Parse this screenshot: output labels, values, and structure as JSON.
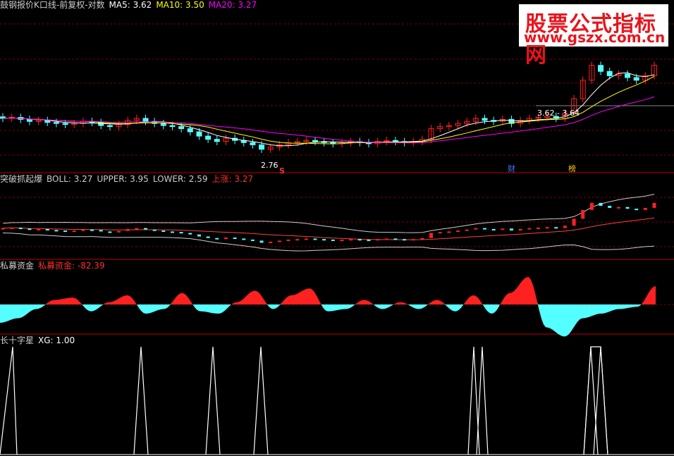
{
  "panel1": {
    "title": "鼓钢报价K口线-前复权-对数",
    "ma5_label": "MA5: 3.62",
    "ma10_label": "MA10: 3.50",
    "ma20_label": "MA20: 3.27",
    "low_marker": "2.76",
    "range_marker": "3.62 - 3.64",
    "event_s": "S",
    "event_cai": "财",
    "event_bang": "榜"
  },
  "panel2": {
    "title": "突破抓起爆",
    "boll_label": "BOLL: 3.27",
    "upper_label": "UPPER: 3.95",
    "lower_label": "LOWER: 2.59",
    "rise_label": "上涨: 3.27"
  },
  "panel3": {
    "title": "私募资金",
    "value_label": "私募资金: -82.39"
  },
  "panel4": {
    "title": "长十字星",
    "xg_label": "XG: 1.00"
  },
  "watermark": {
    "line1": "股票公式指标网",
    "line2": "www.gszx.com.cn"
  },
  "colors": {
    "up": "#ff2020",
    "down": "#54ffff",
    "ma5": "#ffffff",
    "ma10": "#ffff00",
    "ma20": "#ff00ff",
    "grid": "#7a0000",
    "separator": "#c00000"
  },
  "chart_data": [
    {
      "type": "candlestick",
      "title": "鼓钢报价K口线-前复权-对数",
      "series": [
        {
          "name": "MA5",
          "value": 3.62
        },
        {
          "name": "MA10",
          "value": 3.5
        },
        {
          "name": "MA20",
          "value": 3.27
        }
      ],
      "close": [
        3.05,
        3.06,
        3.04,
        3.02,
        3.03,
        3.01,
        3.0,
        2.99,
        3.0,
        3.02,
        3.01,
        2.98,
        2.97,
        2.99,
        3.03,
        3.05,
        3.02,
        3.0,
        2.98,
        2.97,
        2.95,
        2.92,
        2.88,
        2.85,
        2.83,
        2.86,
        2.84,
        2.82,
        2.8,
        2.76,
        2.78,
        2.8,
        2.82,
        2.83,
        2.84,
        2.83,
        2.82,
        2.81,
        2.82,
        2.83,
        2.82,
        2.81,
        2.83,
        2.84,
        2.83,
        2.82,
        2.83,
        2.85,
        2.95,
        2.97,
        2.98,
        3.0,
        3.02,
        3.05,
        3.03,
        3.02,
        3.04,
        3.0,
        3.03,
        3.05,
        3.06,
        3.07,
        3.05,
        3.1,
        3.25,
        3.45,
        3.62,
        3.55,
        3.5,
        3.52,
        3.48,
        3.45,
        3.5,
        3.62
      ],
      "annotations": [
        "2.76",
        "3.62 - 3.64"
      ]
    },
    {
      "type": "line",
      "title": "突破抓起爆",
      "series": [
        {
          "name": "BOLL",
          "value": 3.27
        },
        {
          "name": "UPPER",
          "value": 3.95
        },
        {
          "name": "LOWER",
          "value": 2.59
        },
        {
          "name": "上涨",
          "value": 3.27
        }
      ]
    },
    {
      "type": "area",
      "title": "私募资金",
      "series": [
        {
          "name": "私募资金",
          "value": -82.39
        }
      ],
      "values": [
        -40,
        -30,
        -10,
        10,
        15,
        -15,
        5,
        20,
        -20,
        -10,
        25,
        -15,
        -20,
        5,
        30,
        -10,
        20,
        35,
        -15,
        -10,
        10,
        -10,
        5,
        -10,
        10,
        -15,
        20,
        -20,
        25,
        60,
        -50,
        -70,
        -30,
        -20,
        -10,
        -5,
        40
      ]
    },
    {
      "type": "line",
      "title": "长十字星",
      "series": [
        {
          "name": "XG",
          "value": 1.0
        }
      ],
      "signals": [
        0,
        1,
        0,
        0,
        0,
        1,
        0,
        1,
        0,
        1,
        0,
        0,
        0,
        0,
        0,
        0,
        1,
        1,
        1,
        0,
        0,
        1,
        1,
        0,
        0
      ]
    }
  ]
}
